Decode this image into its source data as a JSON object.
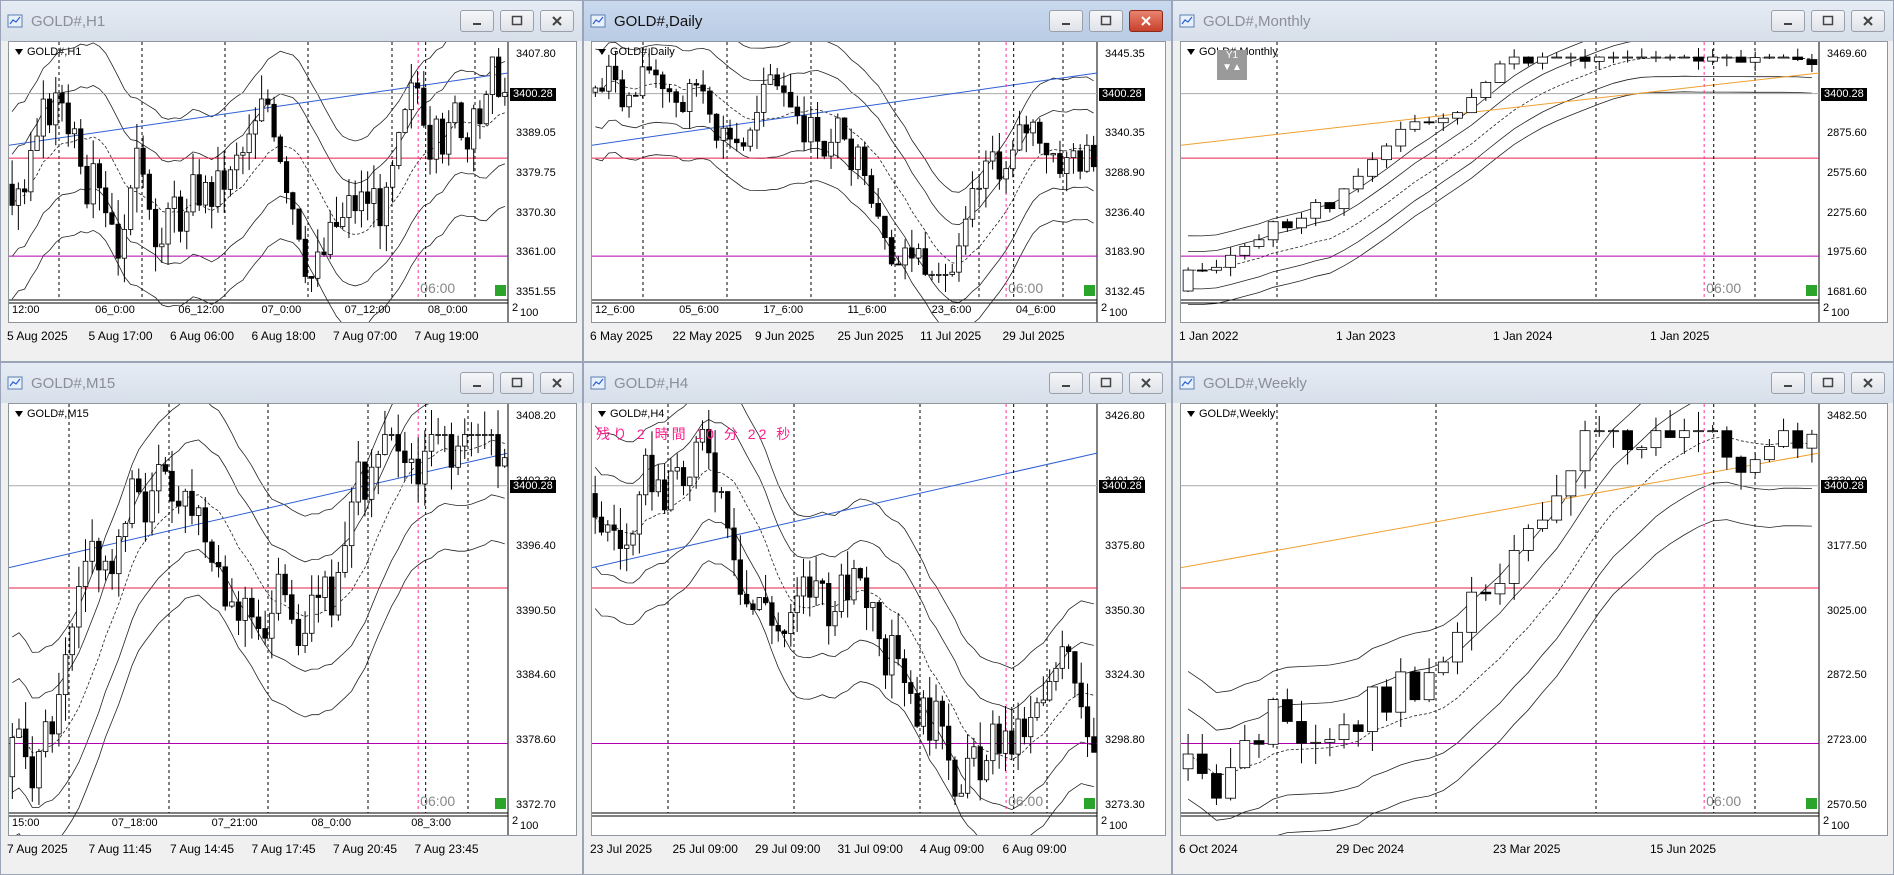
{
  "colors": {
    "red_level": "#e8204a",
    "magenta_level": "#b000b0",
    "blue_trend": "#2d5fd4",
    "orange_trend": "#f0a030",
    "session_line": "#ff3399",
    "band_line": "#222222"
  },
  "windows": [
    {
      "id": "h1",
      "title": "GOLD#,H1",
      "active": false,
      "symbol": "GOLD#,H1",
      "last_price": "3400.28",
      "price_ticks": [
        "3407.80",
        "3398.35",
        "3389.05",
        "3379.75",
        "3370.30",
        "3361.00",
        "3351.55"
      ],
      "time_labels": [
        "12:00",
        "06_0:00",
        "06_12:00",
        "07_0:00",
        "07_12:00",
        "08_0:00"
      ],
      "date_labels": [
        "5 Aug 2025",
        "5 Aug 17:00",
        "6 Aug 06:00",
        "6 Aug 18:00",
        "7 Aug 07:00",
        "7 Aug 19:00"
      ],
      "session_label": "06:00",
      "bottom_labels": [
        "2",
        "100"
      ],
      "seed": 3,
      "trend": 0.35,
      "vol": 0.05,
      "span": [
        0.72,
        0.25
      ],
      "count": 80
    },
    {
      "id": "daily",
      "title": "GOLD#,Daily",
      "active": true,
      "symbol": "GOLD#,Daily",
      "last_price": "3400.28",
      "price_ticks": [
        "3445.35",
        "3392.55",
        "3340.35",
        "3288.90",
        "3236.40",
        "3183.90",
        "3132.45"
      ],
      "time_labels": [
        "12_6:00",
        "05_6:00",
        "17_6:00",
        "11_6:00",
        "23_6:00",
        "04_6:00"
      ],
      "date_labels": [
        "6 May 2025",
        "22 May 2025",
        "9 Jun 2025",
        "25 Jun 2025",
        "11 Jul 2025",
        "29 Jul 2025"
      ],
      "session_label": "06:00",
      "bottom_labels": [
        "2",
        "100"
      ],
      "seed": 7,
      "trend": 0.1,
      "vol": 0.08,
      "span": [
        0.6,
        0.35
      ],
      "count": 75
    },
    {
      "id": "monthly",
      "title": "GOLD#,Monthly",
      "active": false,
      "symbol": "GOLD#,Monthly",
      "last_price": "3400.28",
      "price_ticks": [
        "3469.60",
        "3169.60",
        "2875.60",
        "2575.60",
        "2275.60",
        "1975.60",
        "1681.60"
      ],
      "time_labels": [],
      "date_labels": [
        "1 Jan 2022",
        "1 Jan 2023",
        "1 Jan 2024",
        "1 Jan 2025"
      ],
      "session_label": "06:00",
      "bottom_labels": [
        "2",
        "100"
      ],
      "y1_label": "Y1",
      "seed": 11,
      "trend": 1.6,
      "vol": 0.03,
      "span": [
        0.9,
        0.05
      ],
      "count": 45
    },
    {
      "id": "m15",
      "title": "GOLD#,M15",
      "active": false,
      "symbol": "GOLD#,M15",
      "last_price": "3400.28",
      "price_ticks": [
        "3408.20",
        "3402.30",
        "3396.40",
        "3390.50",
        "3384.60",
        "3378.60",
        "3372.70"
      ],
      "time_labels": [
        "15:00",
        "07_18:00",
        "07_21:00",
        "08_0:00",
        "08_3:00"
      ],
      "date_labels": [
        "7 Aug 2025",
        "7 Aug 11:45",
        "7 Aug 14:45",
        "7 Aug 17:45",
        "7 Aug 20:45",
        "7 Aug 23:45"
      ],
      "session_label": "06:00",
      "bottom_labels": [
        "2",
        "100"
      ],
      "seed": 5,
      "trend": 0.5,
      "vol": 0.06,
      "span": [
        0.75,
        0.2
      ],
      "count": 75
    },
    {
      "id": "h4",
      "title": "GOLD#,H4",
      "active": false,
      "symbol": "GOLD#,H4",
      "last_price": "3400.28",
      "price_ticks": [
        "3426.80",
        "3401.30",
        "3375.80",
        "3350.30",
        "3324.30",
        "3298.80",
        "3273.30"
      ],
      "time_labels": [],
      "date_labels": [
        "23 Jul 2025",
        "25 Jul 09:00",
        "29 Jul 09:00",
        "31 Jul 09:00",
        "4 Aug 09:00",
        "6 Aug 09:00"
      ],
      "session_label": "06:00",
      "bottom_labels": [
        "2",
        "100"
      ],
      "countdown": "残り 2 時間 10 分 22 秒",
      "seed": 9,
      "trend": -0.2,
      "vol": 0.06,
      "span": [
        0.8,
        0.1
      ],
      "count": 80
    },
    {
      "id": "weekly",
      "title": "GOLD#,Weekly",
      "active": false,
      "symbol": "GOLD#,Weekly",
      "last_price": "3400.28",
      "price_ticks": [
        "3482.50",
        "3330.00",
        "3177.50",
        "3025.00",
        "2872.50",
        "2723.00",
        "2570.50"
      ],
      "time_labels": [],
      "date_labels": [
        "6 Oct 2024",
        "29 Dec 2024",
        "23 Mar 2025",
        "15 Jun 2025"
      ],
      "session_label": "06:00",
      "bottom_labels": [
        "2",
        "100"
      ],
      "seed": 13,
      "trend": 1.2,
      "vol": 0.05,
      "span": [
        0.88,
        0.15
      ],
      "count": 45
    }
  ]
}
